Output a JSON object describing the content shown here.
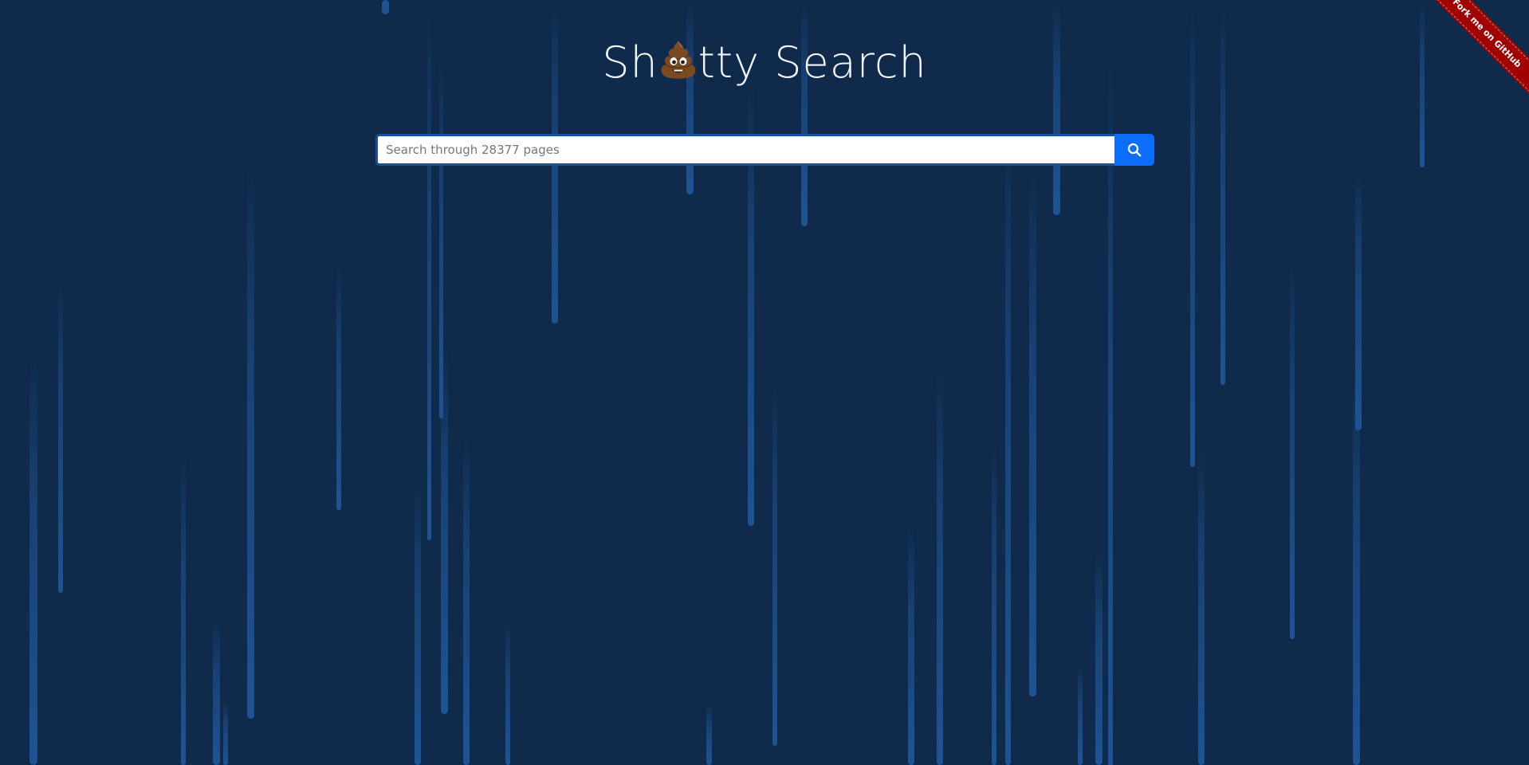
{
  "header": {
    "title_prefix": "Sh",
    "title_suffix": "tty Search",
    "title_emoji": "poop-emoji"
  },
  "search": {
    "placeholder": "Search through 28377 pages",
    "button_icon": "search-icon"
  },
  "ribbon": {
    "label": "Fork me on GitHub"
  },
  "colors": {
    "background": "#0f2a4a",
    "rain": "#1e5494",
    "search_button": "#0d6efd",
    "ribbon": "#a00000"
  }
}
